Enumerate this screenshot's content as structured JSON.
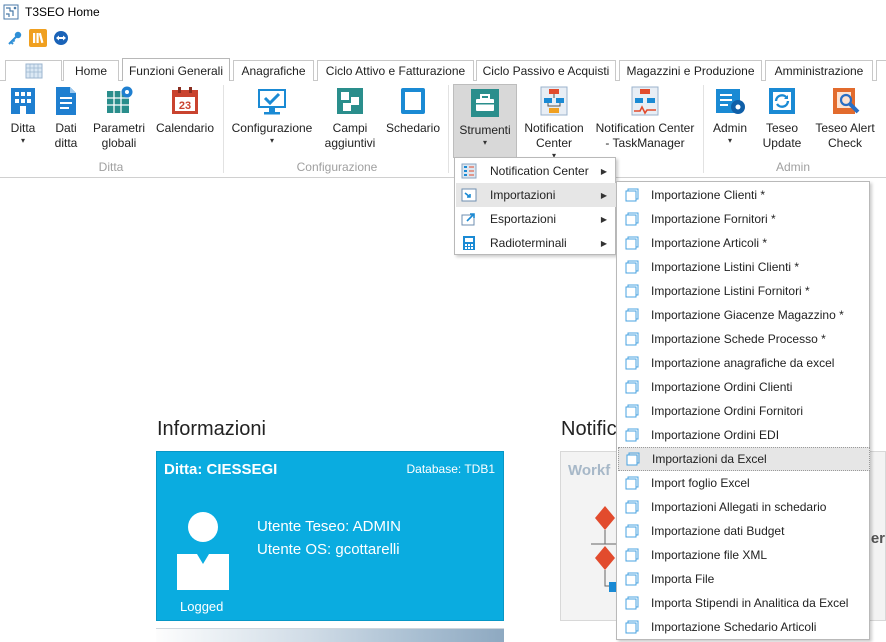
{
  "window": {
    "title": "T3SEO Home"
  },
  "quick_access": [
    {
      "icon": "key-icon",
      "color": "#2f8fd6"
    },
    {
      "icon": "library-icon",
      "color": "#f0a020"
    },
    {
      "icon": "teamviewer-icon",
      "color": "#1a63b8"
    }
  ],
  "tabs": [
    {
      "label": ""
    },
    {
      "label": "Home"
    },
    {
      "label": "Funzioni Generali"
    },
    {
      "label": "Anagrafiche"
    },
    {
      "label": "Ciclo Attivo e Fatturazione"
    },
    {
      "label": "Ciclo Passivo e Acquisti"
    },
    {
      "label": "Magazzini e Produzione"
    },
    {
      "label": "Amministrazione"
    },
    {
      "label": ""
    }
  ],
  "ribbon": {
    "groups": [
      {
        "label": "Ditta"
      },
      {
        "label": "Configurazione"
      },
      {
        "label": "Admin"
      }
    ],
    "buttons": [
      {
        "line1": "Ditta",
        "line2": "",
        "icon": "building-icon",
        "dropdown": "▾"
      },
      {
        "line1": "Dati",
        "line2": "ditta",
        "icon": "document-icon"
      },
      {
        "line1": "Parametri",
        "line2": "globali",
        "icon": "spreadsheet-gear-icon"
      },
      {
        "line1": "Calendario",
        "line2": "",
        "icon": "calendar-icon",
        "day": "23"
      },
      {
        "line1": "Configurazione",
        "line2": "",
        "icon": "monitor-check-icon",
        "dropdown": "▾"
      },
      {
        "line1": "Campi",
        "line2": "aggiuntivi",
        "icon": "blocks-icon"
      },
      {
        "line1": "Schedario",
        "line2": "",
        "icon": "card-file-icon"
      },
      {
        "line1": "Strumenti",
        "line2": "",
        "icon": "toolbox-icon",
        "dropdown": "▾"
      },
      {
        "line1": "Notification",
        "line2": "Center",
        "icon": "flowchart-icon",
        "dropdown": "▾"
      },
      {
        "line1": "Notification Center",
        "line2": "- TaskManager",
        "icon": "flowchart-task-icon"
      },
      {
        "line1": "Admin",
        "line2": "",
        "icon": "admin-gear-icon",
        "dropdown": "▾"
      },
      {
        "line1": "Teseo",
        "line2": "Update",
        "icon": "update-icon"
      },
      {
        "line1": "Teseo Alert",
        "line2": "Check",
        "icon": "alert-check-icon"
      }
    ]
  },
  "strumenti_menu": [
    {
      "label": "Notification Center",
      "icon": "list-icon"
    },
    {
      "label": "Importazioni",
      "icon": "import-icon"
    },
    {
      "label": "Esportazioni",
      "icon": "export-icon"
    },
    {
      "label": "Radioterminali",
      "icon": "terminal-icon"
    }
  ],
  "importazioni_menu": [
    "Importazione Clienti *",
    "Importazione Fornitori *",
    "Importazione Articoli *",
    "Importazione Listini Clienti *",
    "Importazione Listini Fornitori *",
    "Importazione Giacenze Magazzino *",
    "Importazione Schede Processo *",
    "Importazione anagrafiche da excel",
    "Importazione Ordini Clienti",
    "Importazione Ordini Fornitori",
    "Importazione Ordini EDI",
    "Importazioni da Excel",
    "Import foglio Excel",
    "Importazioni Allegati in schedario",
    "Importazione dati Budget",
    "Importazione file XML",
    "Importa File",
    "Importa Stipendi in Analitica da Excel",
    "Importazione Schedario Articoli"
  ],
  "informazioni": {
    "title": "Informazioni",
    "firm": "Ditta: CIESSEGI",
    "database": "Database: TDB1",
    "user_teseo": "Utente Teseo: ADMIN",
    "user_os": "Utente OS: gcottarelli",
    "status": "Logged"
  },
  "notifiche": {
    "title": "Notific",
    "panel_title": "Workf",
    "panel_text": "er"
  },
  "colors": {
    "card": "#0aace0",
    "accent": "#1a8ad4"
  }
}
